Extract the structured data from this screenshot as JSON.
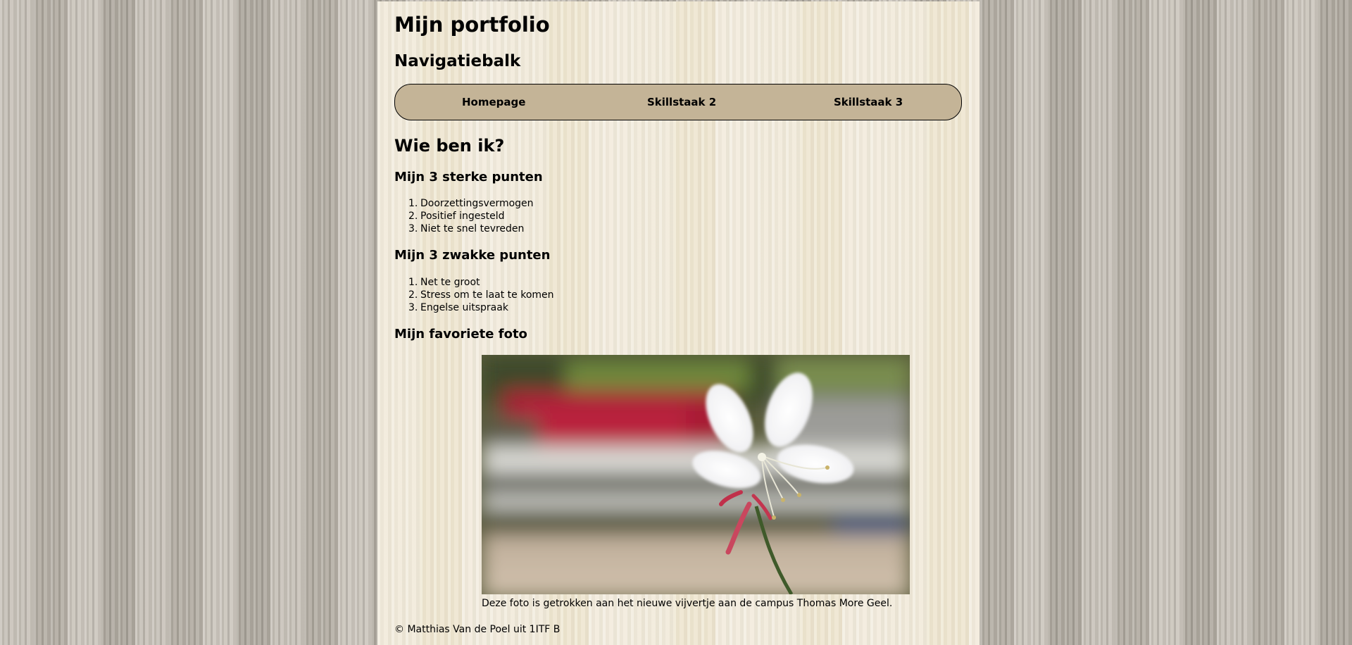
{
  "header": {
    "title": "Mijn portfolio"
  },
  "navigation": {
    "heading": "Navigatiebalk",
    "links": [
      {
        "label": "Homepage"
      },
      {
        "label": "Skillstaak 2"
      },
      {
        "label": "Skillstaak 3"
      }
    ]
  },
  "main": {
    "heading": "Wie ben ik?",
    "strengths": {
      "heading": "Mijn 3 sterke punten",
      "items": [
        "Doorzettingsvermogen",
        "Positief ingesteld",
        "Niet te snel tevreden"
      ]
    },
    "weaknesses": {
      "heading": "Mijn 3 zwakke punten",
      "items": [
        "Net te groot",
        "Stress om te laat te komen",
        "Engelse uitspraak"
      ]
    },
    "favorite_photo": {
      "heading": "Mijn favoriete foto",
      "caption": "Deze foto is getrokken aan het nieuwe vijvertje aan de campus Thomas More Geel."
    }
  },
  "footer": {
    "text": "© Matthias Van de Poel uit 1ITF B"
  },
  "colors": {
    "navbar_background": "#c4b497",
    "content_background": "#f0e8d4",
    "page_background": "#bdb7ae"
  }
}
